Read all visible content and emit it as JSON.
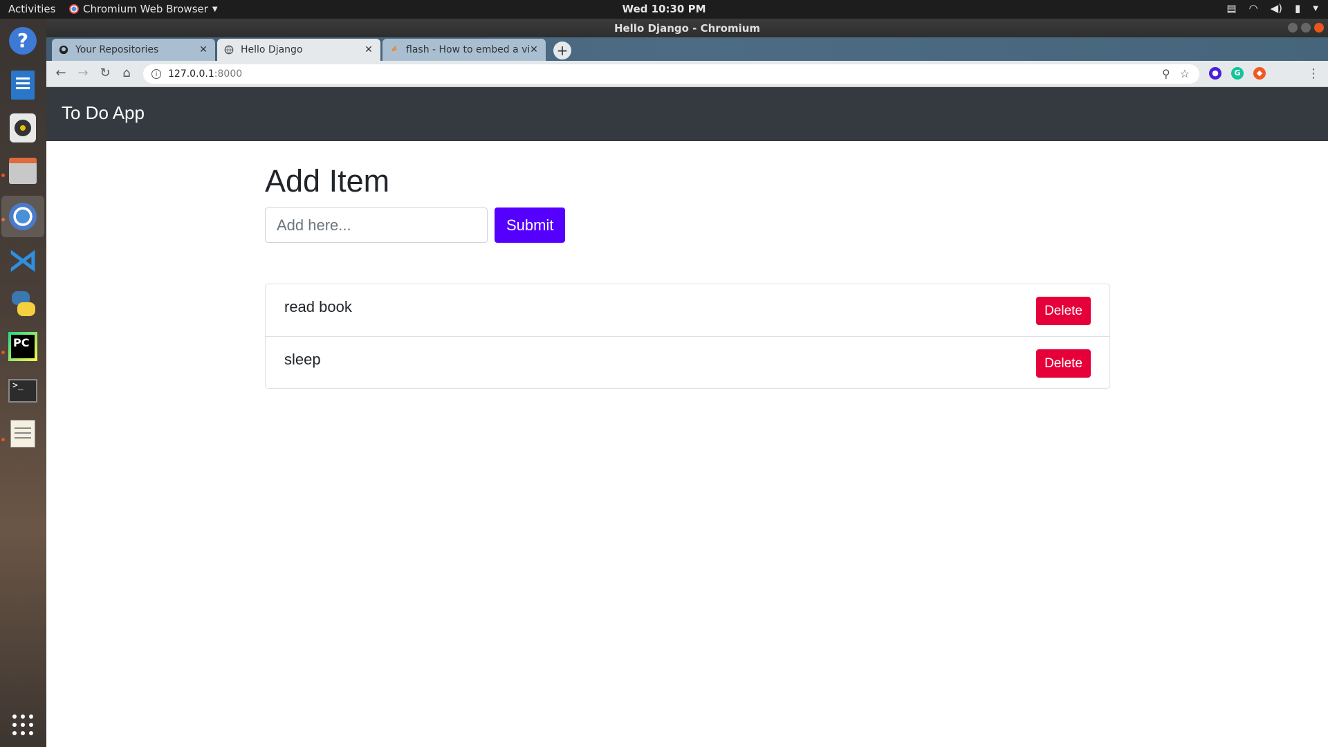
{
  "os": {
    "activities": "Activities",
    "app_menu": "Chromium Web Browser",
    "clock": "Wed 10:30 PM"
  },
  "window": {
    "title": "Hello Django - Chromium"
  },
  "tabs": [
    {
      "label": "Your Repositories",
      "icon": "github-icon"
    },
    {
      "label": "Hello Django",
      "icon": "globe-icon"
    },
    {
      "label": "flash - How to embed a vid",
      "icon": "stackoverflow-icon"
    }
  ],
  "omnibox": {
    "host": "127.0.0.1",
    "port": ":8000"
  },
  "app": {
    "brand": "To Do App",
    "heading": "Add Item",
    "input_placeholder": "Add here...",
    "submit_label": "Submit",
    "items": [
      {
        "text": "read book",
        "delete_label": "Delete"
      },
      {
        "text": "sleep",
        "delete_label": "Delete"
      }
    ]
  },
  "colors": {
    "navbar": "#343a40",
    "submit": "#5500ff",
    "delete": "#e6003a"
  }
}
